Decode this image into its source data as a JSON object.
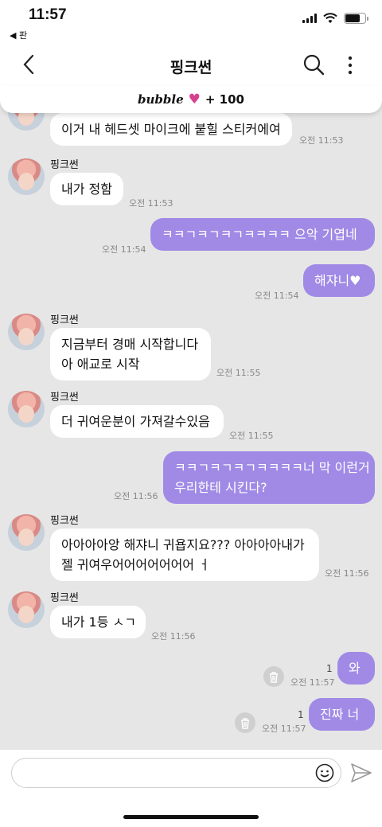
{
  "status_bar": {
    "time": "11:57",
    "back_app": "◀ 판",
    "battery_level": 0.75
  },
  "nav": {
    "title": "핑크썬",
    "back_icon": "chevron-left-icon",
    "search_icon": "search-icon",
    "more_icon": "more-vertical-icon"
  },
  "bubble_bar": {
    "logo": "bubble",
    "heart": "♥",
    "count": "+ 100"
  },
  "messages": [
    {
      "text": "이거 내 헤드셋 마이크에 붙힐 스티커에여",
      "time": "오전 11:53"
    },
    {
      "sender": "핑크썬",
      "text": "내가 정함",
      "time": "오전 11:53"
    },
    {
      "text": "ㅋㅋㄱㅋㄱㅋㄱㅋㅋㅋㅋ 으악 기엽네",
      "time": "오전 11:54"
    },
    {
      "text": "해쟈니♥",
      "time": "오전 11:54"
    },
    {
      "sender": "핑크썬",
      "lines": [
        "지금부터 경매 시작합니다",
        "아 애교로 시작"
      ],
      "time": "오전 11:55"
    },
    {
      "sender": "핑크썬",
      "text": "더 귀여운분이 가져갈수있음",
      "time": "오전 11:55"
    },
    {
      "lines": [
        "ㅋㅋㄱㅋㄱㅋㄱㅋㅋㅋㅋ너 막 이런거",
        "우리한테 시킨다?"
      ],
      "time": "오전 11:56"
    },
    {
      "sender": "핑크썬",
      "lines": [
        "아아아아앙 해쟈니 귀욥지요??? 아아아아내가",
        "젤 귀여우어어어어어어어 ㅓ"
      ],
      "time": "오전 11:56"
    },
    {
      "sender": "핑크썬",
      "text": "내가 1등 ㅅㄱ",
      "time": "오전 11:56"
    },
    {
      "text": "와",
      "time": "오전 11:57",
      "unread": "1"
    },
    {
      "text": "진짜 너",
      "time": "오전 11:57",
      "unread": "1"
    }
  ],
  "composer": {
    "placeholder": "",
    "emoji_icon": "smile-icon",
    "send_icon": "send-icon"
  },
  "colors": {
    "my_bubble": "#a08ae6",
    "their_bubble": "#ffffff",
    "background": "#e6e6e6",
    "heart": "#d6408f"
  }
}
